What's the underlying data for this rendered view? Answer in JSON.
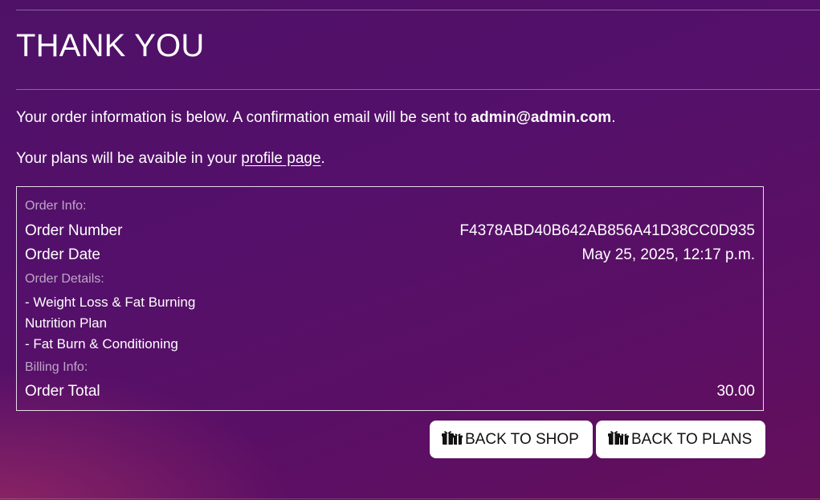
{
  "page": {
    "title": "THANK YOU"
  },
  "intro": {
    "line1_text": "Your order information is below. A confirmation email will be sent to ",
    "email": "admin@admin.com",
    "line1_end": ".",
    "line2_text": "Your plans will be avaible in your ",
    "profile_link": "profile page",
    "line2_end": "."
  },
  "order": {
    "info_label": "Order Info:",
    "number_label": "Order Number",
    "number_value": "F4378ABD40B642AB856A41D38CC0D935",
    "date_label": "Order Date",
    "date_value": "May 25, 2025, 12:17 p.m.",
    "details_label": "Order Details:",
    "items": [
      "- Weight Loss & Fat Burning Nutrition Plan",
      "- Fat Burn & Conditioning"
    ],
    "billing_label": "Billing Info:",
    "total_label": "Order Total",
    "total_value": "30.00"
  },
  "buttons": {
    "shop_label": "BACK TO SHOP",
    "plans_label": "BACK TO PLANS",
    "icon": "gifts-icon"
  }
}
